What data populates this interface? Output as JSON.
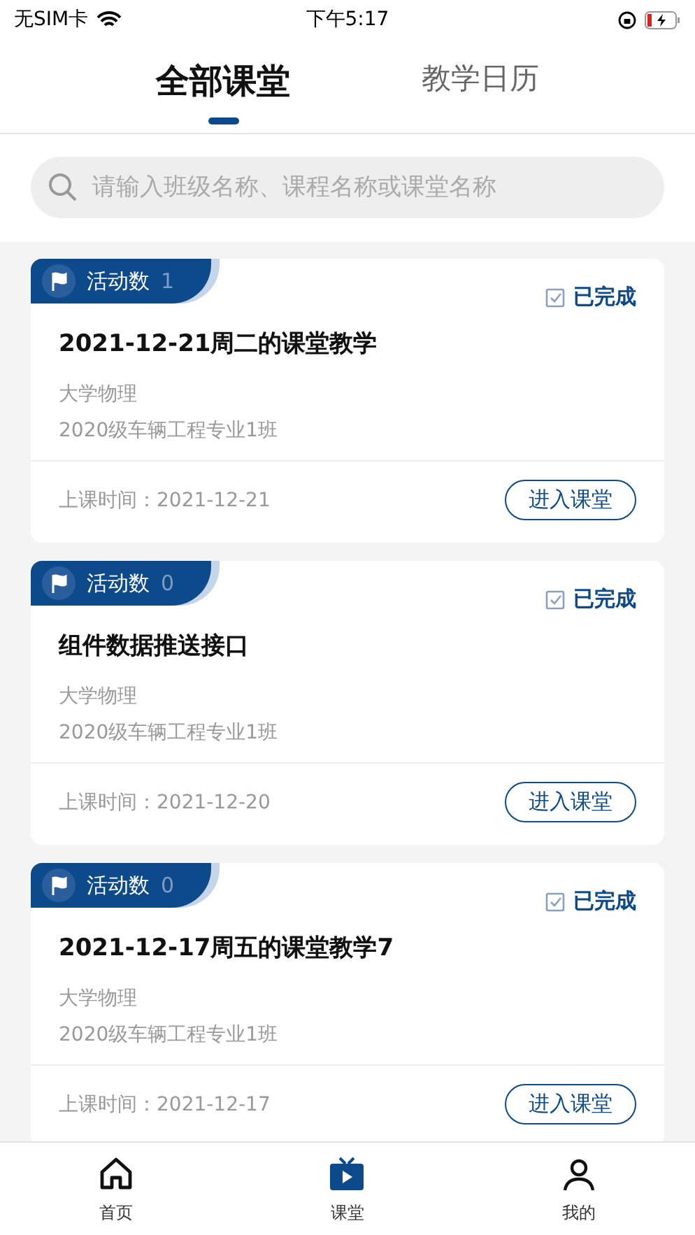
{
  "status_bar": {
    "carrier": "无SIM卡",
    "time": "下午5:17"
  },
  "tabs": [
    {
      "label": "全部课堂",
      "selected": true
    },
    {
      "label": "教学日历",
      "selected": false
    }
  ],
  "search": {
    "placeholder": "请输入班级名称、课程名称或课堂名称"
  },
  "classes": [
    {
      "activity_label": "活动数",
      "activity_count": "1",
      "status": "已完成",
      "title": "2021-12-21周二的课堂教学",
      "course": "大学物理",
      "class_name": "2020级车辆工程专业1班",
      "time_label": "上课时间：",
      "date": "2021-12-21",
      "button": "进入课堂"
    },
    {
      "activity_label": "活动数",
      "activity_count": "0",
      "status": "已完成",
      "title": "组件数据推送接口",
      "course": "大学物理",
      "class_name": "2020级车辆工程专业1班",
      "time_label": "上课时间：",
      "date": "2021-12-20",
      "button": "进入课堂"
    },
    {
      "activity_label": "活动数",
      "activity_count": "0",
      "status": "已完成",
      "title": "2021-12-17周五的课堂教学7",
      "course": "大学物理",
      "class_name": "2020级车辆工程专业1班",
      "time_label": "上课时间：",
      "date": "2021-12-17",
      "button": "进入课堂"
    }
  ],
  "nav": [
    {
      "kind": "home",
      "label": "首页",
      "selected": false
    },
    {
      "kind": "classroom",
      "label": "课堂",
      "selected": true
    },
    {
      "kind": "profile",
      "label": "我的",
      "selected": false
    }
  ]
}
